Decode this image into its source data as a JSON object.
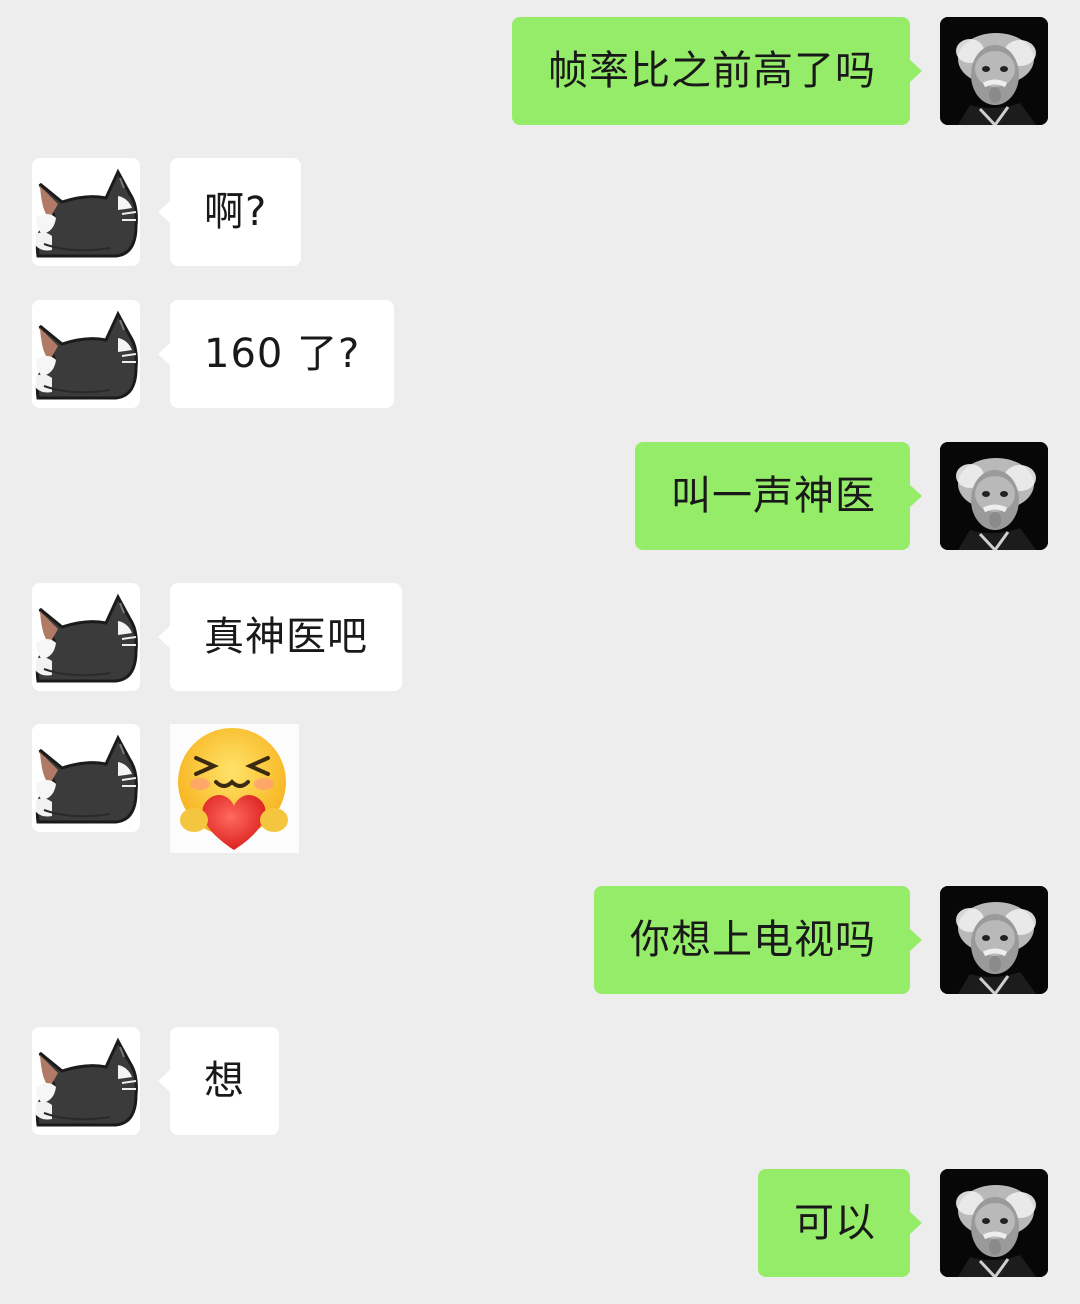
{
  "messages": [
    {
      "sender": "me",
      "type": "text",
      "text": "帧率比之前高了吗"
    },
    {
      "sender": "them",
      "type": "text",
      "text": "啊?"
    },
    {
      "sender": "them",
      "type": "text",
      "text": "160 了?"
    },
    {
      "sender": "me",
      "type": "text",
      "text": "叫一声神医"
    },
    {
      "sender": "them",
      "type": "text",
      "text": "真神医吧"
    },
    {
      "sender": "them",
      "type": "sticker",
      "sticker": "blushing-face-hugging-heart-emoji"
    },
    {
      "sender": "me",
      "type": "text",
      "text": "你想上电视吗"
    },
    {
      "sender": "them",
      "type": "text",
      "text": "想"
    },
    {
      "sender": "me",
      "type": "text",
      "text": "可以"
    }
  ],
  "avatars": {
    "me": "einstein-tongue-photo",
    "them": "black-cat-sticker"
  },
  "colors": {
    "background": "#ededed",
    "my_bubble": "#95ec69",
    "their_bubble": "#ffffff",
    "text": "#191919"
  }
}
